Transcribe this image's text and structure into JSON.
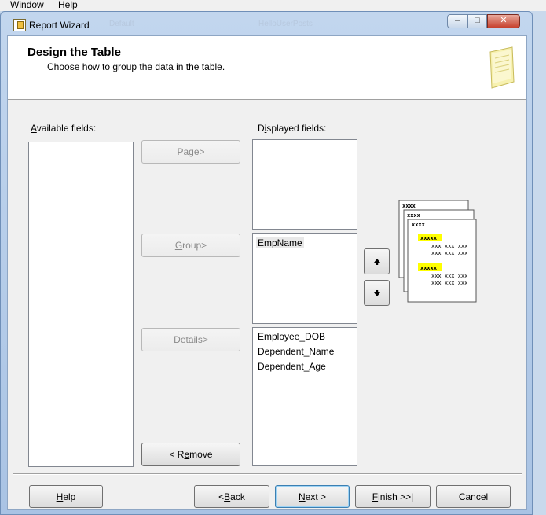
{
  "menubar": {
    "items": [
      "Window",
      "Help"
    ]
  },
  "window": {
    "title": "Report Wizard",
    "ghost_tabs": [
      "Default",
      "HelloUserPosts"
    ],
    "caption_buttons": {
      "minimize": "–",
      "maximize": "□",
      "close": "✕"
    }
  },
  "header": {
    "title": "Design the Table",
    "subtitle": "Choose how to group the data in the table."
  },
  "available": {
    "label_accel": "A",
    "label_rest": "vailable fields:",
    "items": []
  },
  "displayed": {
    "label_pre": "D",
    "label_accel": "i",
    "label_rest": "splayed fields:"
  },
  "page_box": {
    "items": []
  },
  "group_box": {
    "items": [
      "EmpName"
    ]
  },
  "details_box": {
    "items": [
      "Employee_DOB",
      "Dependent_Name",
      "Dependent_Age"
    ]
  },
  "buttons": {
    "page": {
      "accel": "P",
      "rest": "age>"
    },
    "group": {
      "accel": "G",
      "rest": "roup>"
    },
    "details": {
      "accel": "D",
      "rest": "etails>"
    },
    "remove": {
      "pre": "< R",
      "accel": "e",
      "rest": "move"
    },
    "move_up_icon": "arrow-up-icon",
    "move_down_icon": "arrow-down-icon"
  },
  "preview": {
    "page_labels": [
      "xxxx",
      "xxxx",
      "xxxx"
    ],
    "group_labels": [
      "xxxxx",
      "xxxxx"
    ],
    "detail_rows": [
      "xxx xxx xxx",
      "xxx xxx xxx",
      "xxx xxx xxx",
      "xxx xxx xxx"
    ],
    "highlight_color": "#ffff00"
  },
  "footer": {
    "help": {
      "accel": "H",
      "rest": "elp"
    },
    "back": {
      "pre": "< ",
      "accel": "B",
      "rest": "ack"
    },
    "next": {
      "accel": "N",
      "rest": "ext >"
    },
    "finish": {
      "accel": "F",
      "rest": "inish >>|"
    },
    "cancel": "Cancel"
  }
}
